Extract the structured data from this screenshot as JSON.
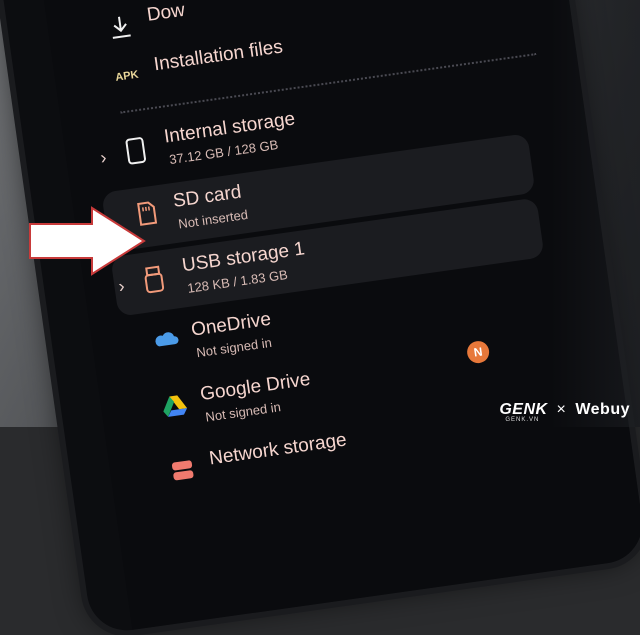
{
  "menu": {
    "top_partial": "Dow",
    "installation": {
      "label": "Installation files",
      "badge": "APK"
    },
    "internal": {
      "title": "Internal storage",
      "sub": "37.12 GB / 128 GB"
    },
    "sdcard": {
      "title": "SD card",
      "sub": "Not inserted"
    },
    "usb": {
      "title": "USB storage 1",
      "sub": "128 KB / 1.83 GB"
    },
    "onedrive": {
      "title": "OneDrive",
      "sub": "Not signed in"
    },
    "gdrive": {
      "title": "Google Drive",
      "sub": "Not signed in",
      "badge": "N"
    },
    "network": {
      "title": "Network storage"
    }
  },
  "watermark": {
    "brand": "GENK",
    "partner": "Webuy",
    "domain": "GENK.VN"
  }
}
